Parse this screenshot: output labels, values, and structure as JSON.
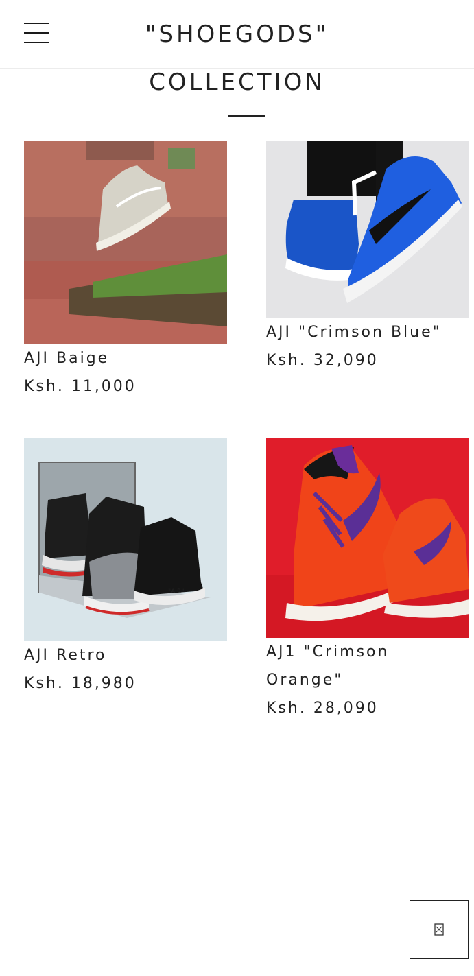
{
  "header": {
    "brand": "\"SHOEGODS\"",
    "menu_icon": "hamburger-menu-icon"
  },
  "collection": {
    "title": "COLLECTION",
    "products": [
      {
        "name": "AJI Baige",
        "price": "Ksh. 11,000",
        "image_icon": "grey-sneaker-photo"
      },
      {
        "name": "AJI \"Crimson Blue\"",
        "price": "Ksh. 32,090",
        "image_icon": "blue-sneaker-photo"
      },
      {
        "name": "AJI Retro",
        "price": "Ksh. 18,980",
        "image_icon": "black-red-sneaker-photo"
      },
      {
        "name": "AJ1 \"Crimson Orange\"",
        "price": "Ksh. 28,090",
        "image_icon": "orange-sneaker-photo"
      }
    ]
  },
  "floating_button": {
    "icon": "chat-icon"
  },
  "colors": {
    "text": "#222222",
    "divider": "#ececec",
    "background": "#ffffff"
  }
}
